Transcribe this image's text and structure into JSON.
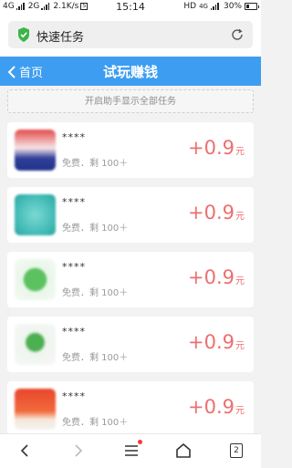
{
  "status_bar": {
    "sim1_label": "4G",
    "sim2_label": "2G",
    "speed": "2.1K/s",
    "time": "15:14",
    "hd_label": "HD",
    "net_label": "4G",
    "battery": "30%"
  },
  "url_bar": {
    "title": "快速任务",
    "icon": "shield-check-icon",
    "action_icon": "refresh-icon"
  },
  "header": {
    "back_label": "首页",
    "title": "试玩赚钱",
    "color": "#3d9df0"
  },
  "notice": {
    "text": "开启助手显示全部任务"
  },
  "tasks": [
    {
      "name": "****",
      "meta": "免费．剩 100＋",
      "reward": "+0.9",
      "unit": "元",
      "thumb_color": "#e24a4a"
    },
    {
      "name": "****",
      "meta": "免费．剩 100＋",
      "reward": "+0.9",
      "unit": "元",
      "thumb_color": "#4ec6c2"
    },
    {
      "name": "****",
      "meta": "免费．剩 100＋",
      "reward": "+0.9",
      "unit": "元",
      "thumb_color": "#5cc25f"
    },
    {
      "name": "****",
      "meta": "免费．剩 100＋",
      "reward": "+0.9",
      "unit": "元",
      "thumb_color": "#4caf50"
    },
    {
      "name": "****",
      "meta": "免费．剩 100＋",
      "reward": "+0.9",
      "unit": "元",
      "thumb_color": "#e8462c"
    }
  ],
  "reward_color": "#ef6e6e",
  "bottom_nav": {
    "back_icon": "chevron-left-icon",
    "forward_icon": "chevron-right-icon",
    "menu_icon": "menu-icon",
    "home_icon": "home-icon",
    "tabs_count": "2"
  }
}
